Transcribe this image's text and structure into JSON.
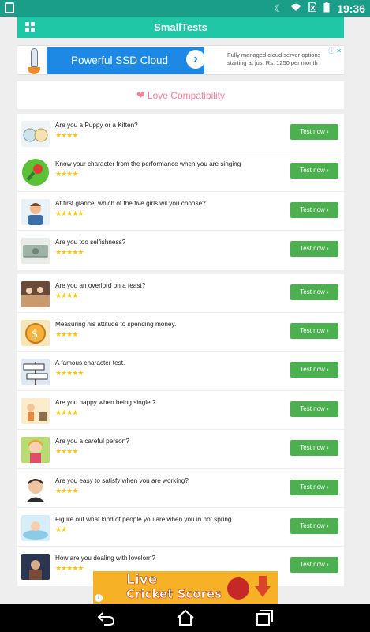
{
  "status_bar": {
    "time": "19:36",
    "icons": [
      "notification-icon",
      "moon-icon",
      "wifi-icon",
      "no-sim-icon",
      "battery-icon"
    ]
  },
  "app_bar": {
    "title": "SmallTests",
    "menu_icon": "grid-icon"
  },
  "ad_top": {
    "cta": "Powerful SSD Cloud",
    "description": "Fully managed cloud server options starting at just Rs. 1250 per month"
  },
  "section": {
    "title": "Love Compatibility",
    "icon": "heart-icon"
  },
  "tests_group_1": [
    {
      "question": "Are you a Puppy or a Kitten?",
      "rating": 4,
      "button": "Test now ›"
    },
    {
      "question": "Know your character from the performance when you are singing",
      "rating": 4,
      "button": "Test now ›"
    },
    {
      "question": "At first glance, which of the five girls wil you choose?",
      "rating": 5,
      "button": "Test now ›"
    },
    {
      "question": "Are you too selfishness?",
      "rating": 5,
      "button": "Test now ›"
    }
  ],
  "tests_group_2": [
    {
      "question": "Are you an overlord on a feast?",
      "rating": 4,
      "button": "Test now ›"
    },
    {
      "question": "Measuring his attitude to spending money.",
      "rating": 4,
      "button": "Test now ›"
    },
    {
      "question": "A famous character test.",
      "rating": 5,
      "button": "Test now ›"
    },
    {
      "question": "Are you happy when being single ?",
      "rating": 4,
      "button": "Test now ›"
    },
    {
      "question": "Are you a careful person?",
      "rating": 4,
      "button": "Test now ›"
    },
    {
      "question": "Are you easy to satisfy when you are working?",
      "rating": 4,
      "button": "Test now ›"
    },
    {
      "question": "Figure out what kind of people you are when you in hot spring.",
      "rating": 2,
      "button": "Test now ›"
    },
    {
      "question": "How are you dealing with lovelorn?",
      "rating": 5,
      "button": "Test now ›"
    }
  ],
  "ad_bottom": {
    "line1": "Live",
    "line2": "Cricket Scores"
  },
  "colors": {
    "status_bar": "#1a9e8a",
    "app_bar": "#1fc7a6",
    "button": "#4caf50",
    "stars": "#f5c518",
    "heart": "#f47f9b",
    "ad_cta": "#1e88e5"
  }
}
